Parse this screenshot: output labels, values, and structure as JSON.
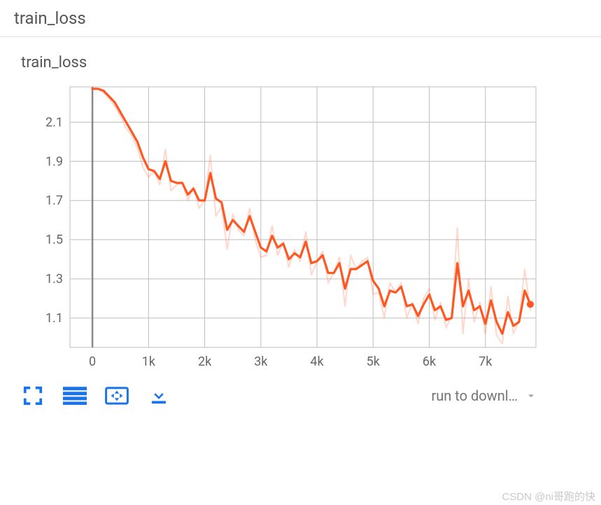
{
  "section": {
    "title": "train_loss"
  },
  "card": {
    "title": "train_loss"
  },
  "run_select": {
    "label": "run to downl…"
  },
  "watermark": "CSDN @ni哥跑的快",
  "chart_data": {
    "type": "line",
    "title": "train_loss",
    "xlabel": "",
    "ylabel": "",
    "xlim": [
      -400,
      7900
    ],
    "ylim": [
      0.95,
      2.28
    ],
    "x_ticks": [
      0,
      1000,
      2000,
      3000,
      4000,
      5000,
      6000,
      7000
    ],
    "x_tick_labels": [
      "0",
      "1k",
      "2k",
      "3k",
      "4k",
      "5k",
      "6k",
      "7k"
    ],
    "y_ticks": [
      1.1,
      1.3,
      1.5,
      1.7,
      1.9,
      2.1
    ],
    "y_tick_labels": [
      "1.1",
      "1.3",
      "1.5",
      "1.7",
      "1.9",
      "2.1"
    ],
    "series": [
      {
        "name": "raw",
        "color": "#ff7043",
        "opacity": 0.28,
        "width": 2,
        "x": [
          0,
          100,
          200,
          300,
          400,
          500,
          600,
          700,
          800,
          900,
          1000,
          1100,
          1200,
          1300,
          1400,
          1500,
          1600,
          1700,
          1800,
          1900,
          2000,
          2100,
          2200,
          2300,
          2400,
          2500,
          2600,
          2700,
          2800,
          2900,
          3000,
          3100,
          3200,
          3300,
          3400,
          3500,
          3600,
          3700,
          3800,
          3900,
          4000,
          4100,
          4200,
          4300,
          4400,
          4500,
          4600,
          4700,
          4800,
          4900,
          5000,
          5100,
          5200,
          5300,
          5400,
          5500,
          5600,
          5700,
          5800,
          5900,
          6000,
          6100,
          6200,
          6300,
          6400,
          6500,
          6600,
          6700,
          6800,
          6900,
          7000,
          7100,
          7200,
          7300,
          7400,
          7500,
          7600,
          7700,
          7800
        ],
        "values": [
          2.27,
          2.27,
          2.25,
          2.22,
          2.18,
          2.13,
          2.07,
          2.03,
          1.97,
          1.87,
          1.82,
          1.85,
          1.78,
          1.96,
          1.75,
          1.78,
          1.79,
          1.7,
          1.77,
          1.66,
          1.7,
          1.93,
          1.62,
          1.67,
          1.45,
          1.63,
          1.55,
          1.52,
          1.66,
          1.5,
          1.41,
          1.42,
          1.57,
          1.42,
          1.49,
          1.36,
          1.45,
          1.39,
          1.54,
          1.32,
          1.39,
          1.44,
          1.28,
          1.33,
          1.41,
          1.16,
          1.42,
          1.35,
          1.39,
          1.41,
          1.22,
          1.23,
          1.1,
          1.28,
          1.23,
          1.28,
          1.1,
          1.18,
          1.07,
          1.2,
          1.25,
          1.09,
          1.18,
          1.05,
          1.11,
          1.56,
          1.02,
          1.3,
          1.08,
          1.18,
          1.02,
          1.26,
          1.01,
          0.97,
          1.21,
          1.02,
          1.09,
          1.35,
          1.14
        ]
      },
      {
        "name": "smoothed",
        "color": "#ff5722",
        "opacity": 1,
        "width": 3.2,
        "x": [
          0,
          100,
          200,
          300,
          400,
          500,
          600,
          700,
          800,
          900,
          1000,
          1100,
          1200,
          1300,
          1400,
          1500,
          1600,
          1700,
          1800,
          1900,
          2000,
          2100,
          2200,
          2300,
          2400,
          2500,
          2600,
          2700,
          2800,
          2900,
          3000,
          3100,
          3200,
          3300,
          3400,
          3500,
          3600,
          3700,
          3800,
          3900,
          4000,
          4100,
          4200,
          4300,
          4400,
          4500,
          4600,
          4700,
          4800,
          4900,
          5000,
          5100,
          5200,
          5300,
          5400,
          5500,
          5600,
          5700,
          5800,
          5900,
          6000,
          6100,
          6200,
          6300,
          6400,
          6500,
          6600,
          6700,
          6800,
          6900,
          7000,
          7100,
          7200,
          7300,
          7400,
          7500,
          7600,
          7700,
          7800
        ],
        "values": [
          2.27,
          2.27,
          2.26,
          2.23,
          2.2,
          2.15,
          2.1,
          2.05,
          2.0,
          1.92,
          1.86,
          1.85,
          1.81,
          1.9,
          1.8,
          1.79,
          1.79,
          1.73,
          1.76,
          1.7,
          1.7,
          1.84,
          1.71,
          1.69,
          1.55,
          1.6,
          1.57,
          1.54,
          1.62,
          1.54,
          1.46,
          1.44,
          1.52,
          1.46,
          1.48,
          1.4,
          1.43,
          1.41,
          1.49,
          1.38,
          1.39,
          1.42,
          1.33,
          1.33,
          1.38,
          1.25,
          1.35,
          1.35,
          1.37,
          1.39,
          1.29,
          1.25,
          1.16,
          1.24,
          1.23,
          1.26,
          1.16,
          1.17,
          1.11,
          1.17,
          1.22,
          1.14,
          1.16,
          1.09,
          1.1,
          1.38,
          1.16,
          1.24,
          1.14,
          1.16,
          1.07,
          1.19,
          1.08,
          1.02,
          1.13,
          1.06,
          1.08,
          1.24,
          1.17
        ]
      }
    ],
    "endpoint_marker": {
      "series": "smoothed",
      "x": 7800,
      "y": 1.17,
      "color": "#ff5722",
      "r": 5
    }
  }
}
